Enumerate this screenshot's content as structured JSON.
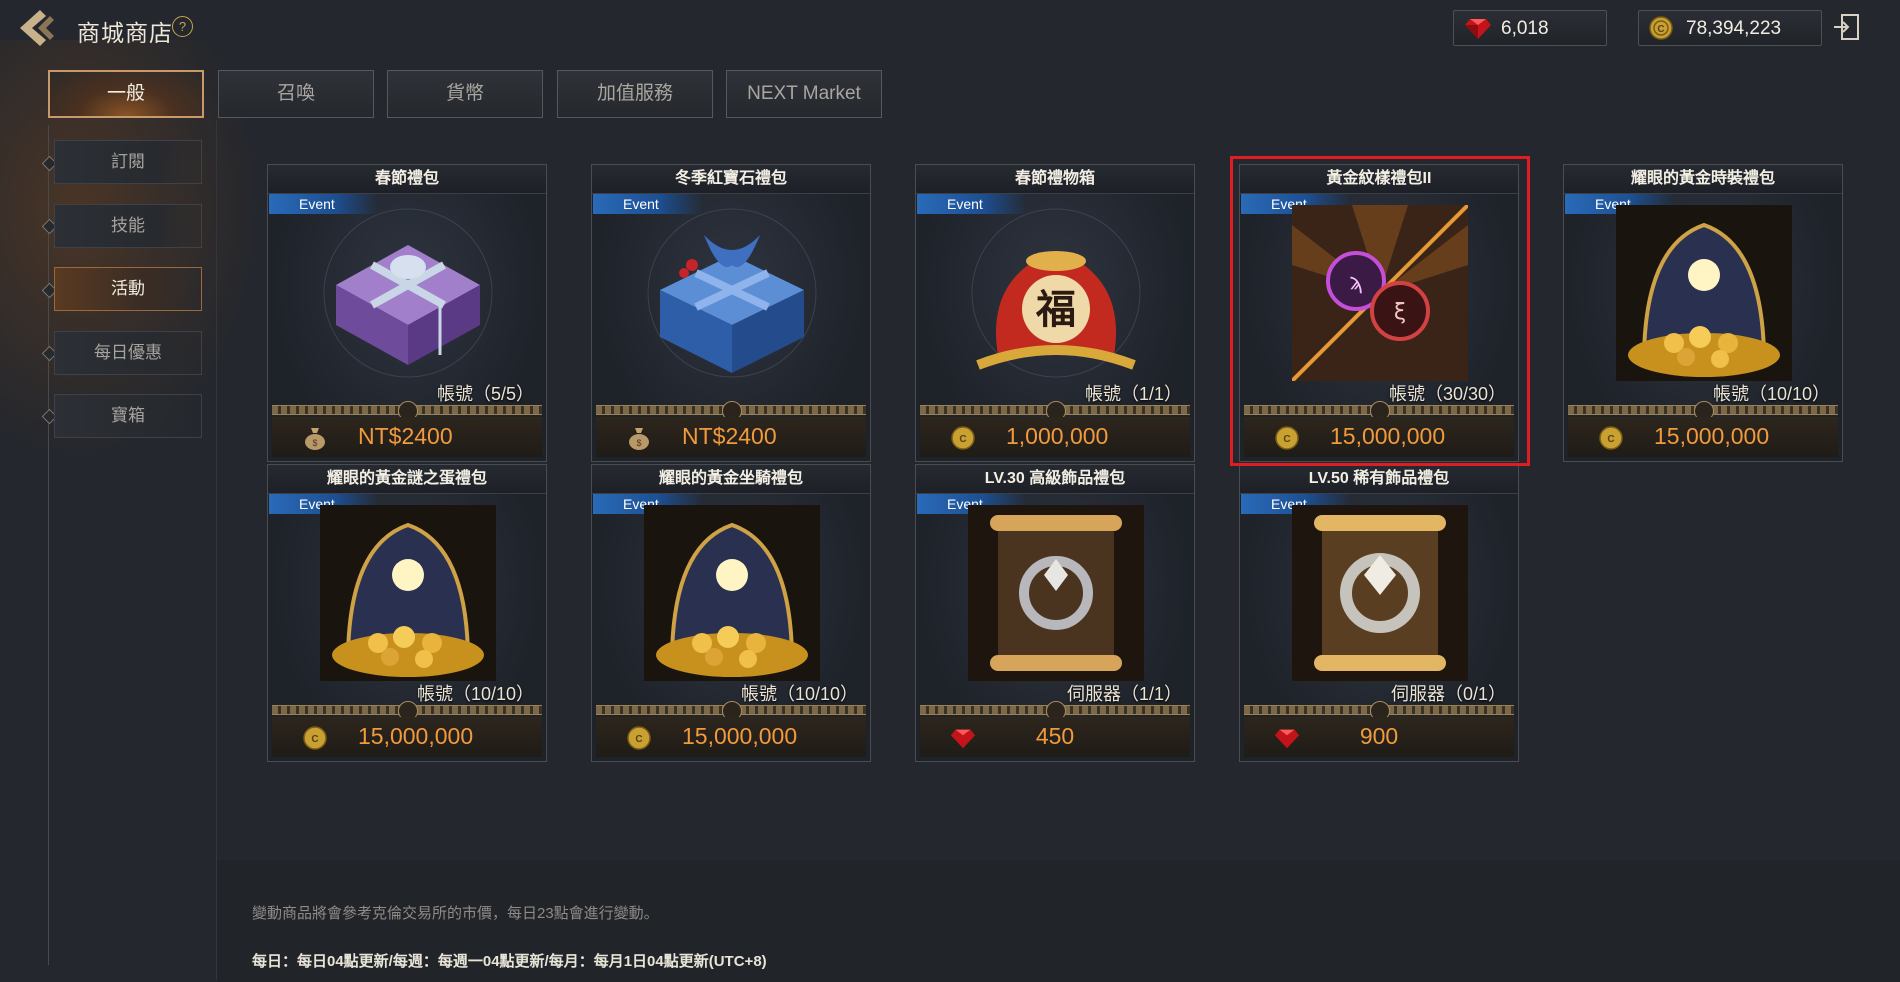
{
  "header": {
    "title": "商城商店",
    "help_label": "?",
    "ruby_amount": "6,018",
    "gold_amount": "78,394,223"
  },
  "tabs": [
    {
      "label": "一般",
      "active": true
    },
    {
      "label": "召喚",
      "active": false
    },
    {
      "label": "貨幣",
      "active": false
    },
    {
      "label": "加值服務",
      "active": false
    },
    {
      "label": "NEXT Market",
      "active": false
    }
  ],
  "sidebar": {
    "items": [
      {
        "label": "訂閱",
        "active": false
      },
      {
        "label": "技能",
        "active": false
      },
      {
        "label": "活動",
        "active": true
      },
      {
        "label": "每日優惠",
        "active": false
      },
      {
        "label": "寶箱",
        "active": false
      }
    ]
  },
  "products": [
    {
      "title": "春節禮包",
      "badge": "Event",
      "limit": "帳號（5/5）",
      "price": "NT$2400",
      "currency": "cash",
      "art": "purple-giftbox"
    },
    {
      "title": "冬季紅寶石禮包",
      "badge": "Event",
      "limit": "",
      "price": "NT$2400",
      "currency": "cash",
      "art": "blue-giftbox"
    },
    {
      "title": "春節禮物箱",
      "badge": "Event",
      "limit": "帳號（1/1）",
      "price": "1,000,000",
      "currency": "gold",
      "art": "fortune-bag"
    },
    {
      "title": "黃金紋樣禮包II",
      "badge": "Event",
      "limit": "帳號（30/30）",
      "price": "15,000,000",
      "currency": "gold",
      "art": "emblem-orbs"
    },
    {
      "title": "耀眼的黃金時裝禮包",
      "badge": "Event",
      "limit": "帳號（10/10）",
      "price": "15,000,000",
      "currency": "gold",
      "art": "gold-treasure"
    },
    {
      "title": "耀眼的黃金謎之蛋禮包",
      "badge": "Event",
      "limit": "帳號（10/10）",
      "price": "15,000,000",
      "currency": "gold",
      "art": "gold-treasure"
    },
    {
      "title": "耀眼的黃金坐騎禮包",
      "badge": "",
      "limit": "帳號（10/10）",
      "price": "15,000,000",
      "currency": "gold",
      "art": "gold-treasure"
    },
    {
      "title": "LV.30 高級飾品禮包",
      "badge": "Event",
      "limit": "伺服器（1/1）",
      "price": "450",
      "currency": "ruby",
      "art": "scroll-ring"
    },
    {
      "title": "LV.50 稀有飾品禮包",
      "badge": "Event",
      "limit": "伺服器（0/1）",
      "price": "900",
      "currency": "ruby",
      "art": "scroll-ring"
    }
  ],
  "footer": {
    "note": "變動商品將會參考克倫交易所的市價，每日23點會進行變動。",
    "reset": "每日：每日04點更新/每週：每週一04點更新/每月：每月1日04點更新(UTC+8)"
  },
  "colors": {
    "price_orange": "#f19a3e",
    "event_blue": "#2a6ab8",
    "highlight_red": "#e01d22",
    "active_tab_border": "#c8996a"
  }
}
